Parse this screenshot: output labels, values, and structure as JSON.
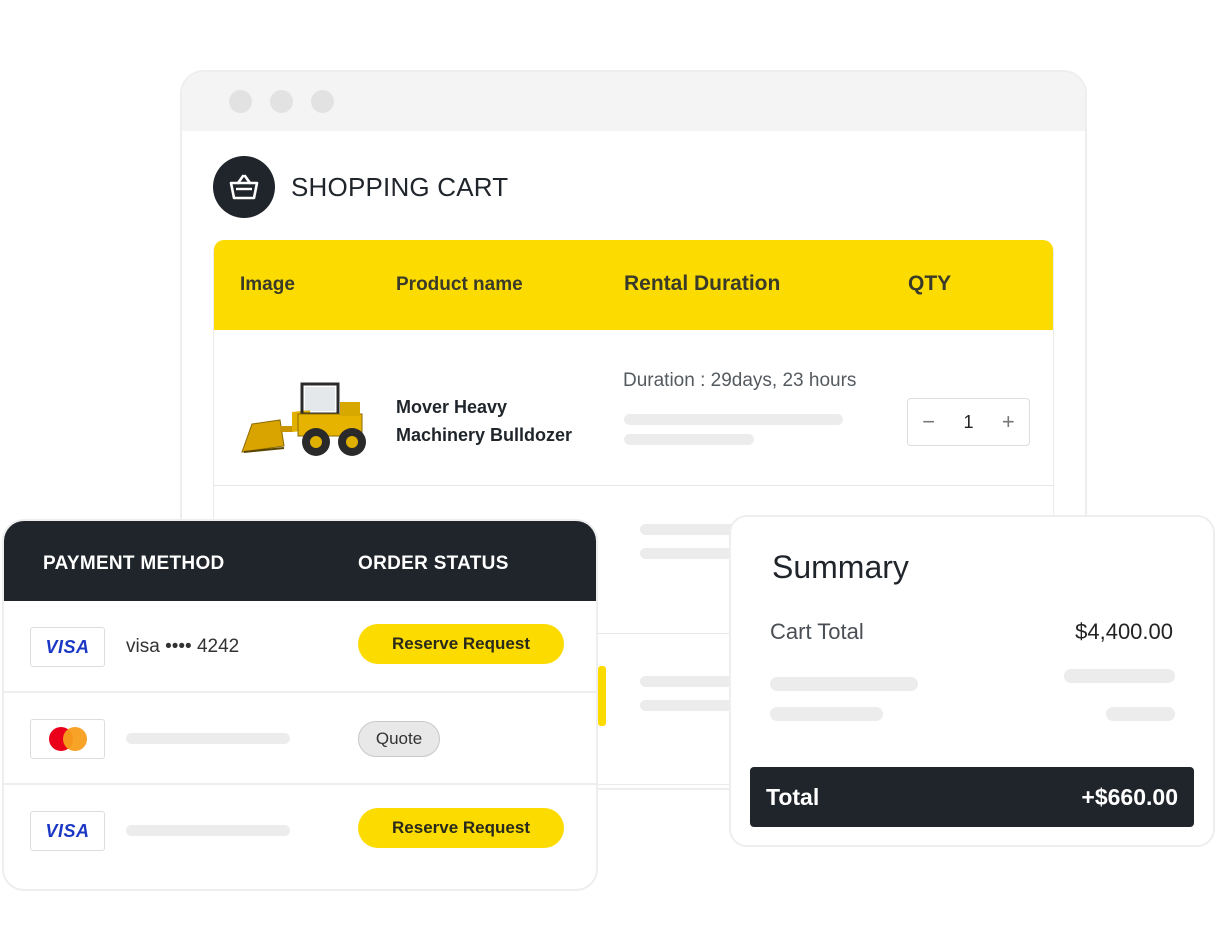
{
  "cart": {
    "title": "SHOPPING CART",
    "columns": {
      "image": "Image",
      "product_name": "Product name",
      "rental_duration": "Rental Duration",
      "qty": "QTY"
    },
    "items": [
      {
        "product_name_line1": "Mover Heavy",
        "product_name_line2": "Machinery Bulldozer",
        "duration": "Duration : 29days, 23 hours",
        "qty": "1",
        "image_icon": "bulldozer-image"
      }
    ]
  },
  "payment": {
    "columns": {
      "method": "PAYMENT METHOD",
      "status": "ORDER STATUS"
    },
    "rows": [
      {
        "card_brand": "VISA",
        "card_number": "visa •••• 4242",
        "status": "Reserve Request"
      },
      {
        "card_brand": "mastercard",
        "card_number": "",
        "status": "Quote"
      },
      {
        "card_brand": "VISA",
        "card_number": "",
        "status": "Reserve Request"
      }
    ]
  },
  "summary": {
    "title": "Summary",
    "cart_total_label": "Cart Total",
    "cart_total_value": "$4,400.00",
    "total_label": "Total",
    "total_value": "+$660.00"
  },
  "colors": {
    "accent": "#fbdb00",
    "dark": "#1f252b",
    "visa_blue": "#1a38c4"
  }
}
